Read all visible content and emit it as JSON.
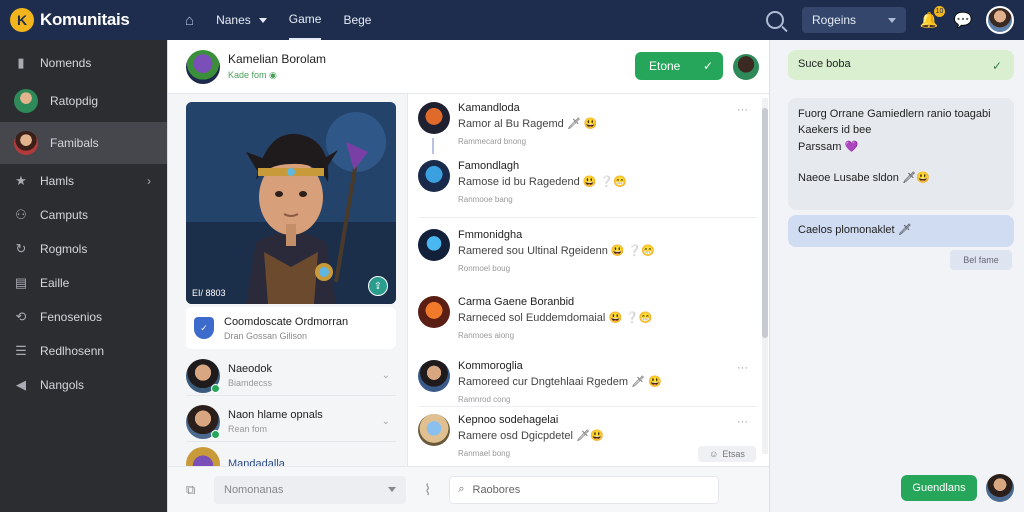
{
  "app": {
    "name": "Komunitais",
    "logo_letter": "K"
  },
  "topnav": {
    "items": [
      {
        "label": "Nanes",
        "has_caret": true,
        "active": false
      },
      {
        "label": "Game",
        "has_caret": false,
        "active": true
      },
      {
        "label": "Bege",
        "has_caret": false,
        "active": false
      }
    ],
    "region_select": "Rogeins",
    "notification_count": "10"
  },
  "sidebar": {
    "items": [
      {
        "label": "Nomends",
        "icon": "bookmark-icon"
      },
      {
        "label": "Ratopdig",
        "icon": "avatar"
      },
      {
        "label": "Famibals",
        "icon": "avatar",
        "active": true
      },
      {
        "label": "Hamls",
        "icon": "star-icon",
        "chevron": true
      },
      {
        "label": "Camputs",
        "icon": "people-icon"
      },
      {
        "label": "Rogmols",
        "icon": "refresh-icon"
      },
      {
        "label": "Eaille",
        "icon": "calendar-icon"
      },
      {
        "label": "Fenosenios",
        "icon": "history-icon"
      },
      {
        "label": "Redlhosenn",
        "icon": "list-icon"
      },
      {
        "label": "Nangols",
        "icon": "megaphone-icon"
      }
    ]
  },
  "chat_header": {
    "title": "Kamelian Borolam",
    "subtitle": "Kade fom",
    "button_label": "Etone"
  },
  "hero": {
    "caption": "EI/ 8803"
  },
  "info_card": {
    "title": "Coomdoscate Ordmorran",
    "subtitle": "Dran Gossan Gilison"
  },
  "contacts": [
    {
      "name": "Naeodok",
      "subtitle": "Biamdecss"
    },
    {
      "name": "Naon hlame opnals",
      "subtitle": "Rean fom"
    },
    {
      "name": "Mandadalla",
      "subtitle": ""
    }
  ],
  "messages": [
    {
      "name": "Kamandloda",
      "text": "Ramor al Bu Ragemd",
      "emoji": "🗡 😃",
      "time": "Rammecard bnong"
    },
    {
      "name": "Famondlagh",
      "text": "Ramose id bu Ragedend",
      "emoji": "😃 ❔😁",
      "time": "Ranmooe bang"
    },
    {
      "name": "Fmmonidgha",
      "text": "Ramered sou Ultinal Rgeidenn",
      "emoji": "😃 ❔😁",
      "time": "Ronmoel boug"
    },
    {
      "name": "Carma Gaene Boranbid",
      "text": "Rarneced sol Euddemdomaial",
      "emoji": "😃 ❔😁",
      "time": "Ranmoes aiong"
    },
    {
      "name": "Kommoroglia",
      "text": "Ramoreed cur Dngtehlaai Rgedem",
      "emoji": "🗡 😃",
      "time": "Ramnrod cong"
    },
    {
      "name": "Kepnoo sodehagelai",
      "text": "Ramere osd Dgicpdetel",
      "emoji": "🗡😃",
      "time": "Ranmael bong"
    }
  ],
  "reaction_chip": "Etsas",
  "bottom_bar": {
    "select_value": "Nomonanas",
    "search_placeholder": "Raobores"
  },
  "right_panel": {
    "bubble_top": "Suce boba",
    "bubble_middle_lines": [
      "Fuorg Orrane Gamiedlern ranio toagabi",
      "Kaekers id bee",
      "Parssam"
    ],
    "bubble_middle_line2": "Naeoe Lusabe sldon",
    "bubble_blue": "Caelos plomonaklet",
    "time_chip": "Bel fame",
    "send_button": "Guendlans"
  },
  "colors": {
    "topbar": "#1e2d4d",
    "sidebar": "#2c2d31",
    "accent_green": "#26a65b",
    "logo": "#f2b51d"
  }
}
